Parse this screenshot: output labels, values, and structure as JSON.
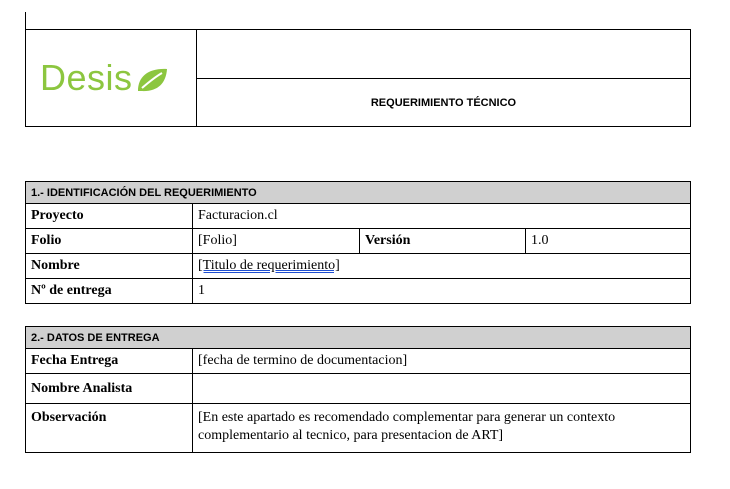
{
  "header": {
    "logo_text": "Desis",
    "title": "REQUERIMIENTO TÉCNICO",
    "logo_color": "#8cc63f"
  },
  "section1": {
    "heading": "1.- IDENTIFICACIÓN DEL REQUERIMIENTO",
    "proyecto_label": "Proyecto",
    "proyecto_value": "Facturacion.cl",
    "folio_label": "Folio",
    "folio_value": "[Folio]",
    "version_label": "Versión",
    "version_value": "1.0",
    "nombre_label": "Nombre",
    "nombre_value": "[Titulo de requerimiento]",
    "entrega_label": "Nº de entrega",
    "entrega_value": "1"
  },
  "section2": {
    "heading": "2.- DATOS DE ENTREGA",
    "fecha_label": "Fecha Entrega",
    "fecha_value": "[fecha de termino de documentacion]",
    "analista_label": "Nombre Analista",
    "analista_value": "",
    "obs_label": "Observación",
    "obs_value": "[En este apartado es recomendado complementar para generar un contexto complementario al tecnico, para presentacion de ART]"
  },
  "colors": {
    "header_fill": "#d0d0d0"
  }
}
